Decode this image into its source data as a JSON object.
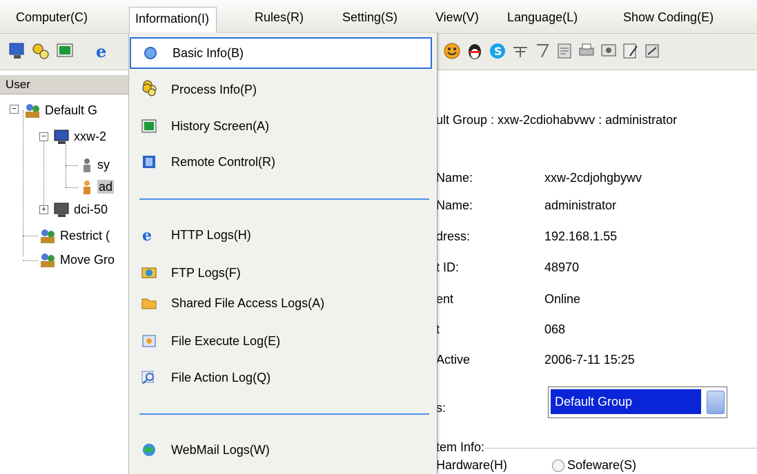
{
  "menubar": {
    "items": [
      "Computer(C)",
      "Information(I)",
      "Rules(R)",
      "Setting(S)",
      "View(V)",
      "Language(L)",
      "Show Coding(E)"
    ],
    "active_index": 1
  },
  "sidebar": {
    "header": "User",
    "tree": {
      "default_group": "Default G",
      "computer_1": "xxw-2",
      "user_sy": "sy",
      "user_ad": "ad",
      "computer_2": "dci-50",
      "restrict": "Restrict (",
      "move_group": "Move Gro"
    }
  },
  "information_menu": {
    "items": [
      {
        "label": "Basic Info(B)",
        "icon": "basic-info-icon"
      },
      {
        "label": "Process Info(P)",
        "icon": "process-gears-icon"
      },
      {
        "label": "History Screen(A)",
        "icon": "history-screen-icon"
      },
      {
        "label": "Remote Control(R)",
        "icon": "remote-control-film-icon"
      },
      {
        "label": "HTTP Logs(H)",
        "icon": "http-logs-ie-icon"
      },
      {
        "label": "FTP Logs(F)",
        "icon": "ftp-logs-icon"
      },
      {
        "label": "Shared File Access Logs(A)",
        "icon": "shared-folder-icon"
      },
      {
        "label": "File Execute Log(E)",
        "icon": "file-execute-icon"
      },
      {
        "label": "File Action Log(Q)",
        "icon": "file-action-icon"
      },
      {
        "label": "WebMail Logs(W)",
        "icon": "webmail-icon"
      }
    ]
  },
  "content": {
    "path": "ult Group : xxw-2cdiohabvwv : administrator",
    "rows": [
      {
        "label": "Name:",
        "value": "xxw-2cdjohgbywv"
      },
      {
        "label": "Name:",
        "value": "administrator"
      },
      {
        "label": "dress:",
        "value": "192.168.1.55"
      },
      {
        "label": "t ID:",
        "value": "48970"
      },
      {
        "label": "ent",
        "value": "Online"
      },
      {
        "label": "t",
        "value": "068"
      },
      {
        "label": "Active",
        "value": "2006-7-11 15:25"
      }
    ],
    "group_label": "s:",
    "group_select": "Default Group",
    "system_info_label": "tem Info:",
    "radio_hardware": "Hardware(H)",
    "radio_software": "Sofeware(S)"
  },
  "colors": {
    "selection_blue": "#0a24d8",
    "menu_highlight_border": "#2e6fd8",
    "separator_blue": "#4f90e8"
  }
}
